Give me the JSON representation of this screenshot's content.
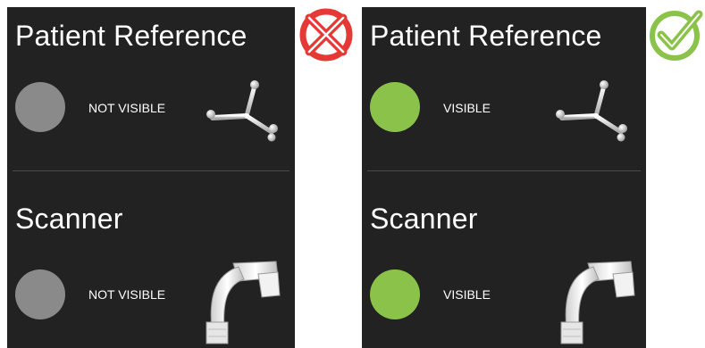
{
  "panels": [
    {
      "reference": {
        "title": "Patient Reference",
        "status": "NOT VISIBLE",
        "indicator_color": "#8a8a8a"
      },
      "scanner": {
        "title": "Scanner",
        "status": "NOT VISIBLE",
        "indicator_color": "#8a8a8a"
      },
      "result_icon": "red-x-circle-icon"
    },
    {
      "reference": {
        "title": "Patient Reference",
        "status": "VISIBLE",
        "indicator_color": "#8bc34a"
      },
      "scanner": {
        "title": "Scanner",
        "status": "VISIBLE",
        "indicator_color": "#8bc34a"
      },
      "result_icon": "green-check-circle-icon"
    }
  ],
  "colors": {
    "panel_bg": "#222222",
    "fail_red": "#e53935",
    "pass_green": "#8bc34a"
  }
}
